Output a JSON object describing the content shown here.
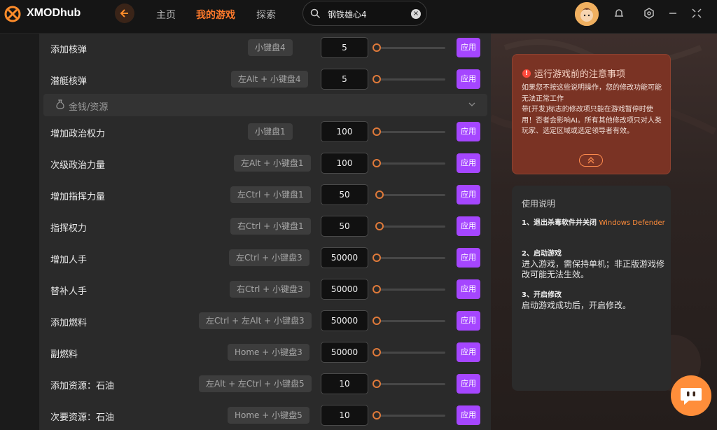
{
  "app": {
    "brand": "XMODhub"
  },
  "nav": {
    "home": "主页",
    "my_games": "我的游戏",
    "explore": "探索"
  },
  "search": {
    "value": "钢铁雄心4",
    "clear_icon": "close-icon"
  },
  "colors": {
    "accent": "#ff7a2b",
    "apply_button": "#a546ff",
    "notice_bg": "#7a3324"
  },
  "rows_top": [
    {
      "label": "添加核弹",
      "hotkey": "小键盘4",
      "value": "5",
      "apply": "应用"
    },
    {
      "label": "潜艇核弹",
      "hotkey": "左Alt + 小键盘4",
      "value": "5",
      "apply": "应用"
    }
  ],
  "section": {
    "label": "金钱/资源"
  },
  "rows": [
    {
      "label": "增加政治权力",
      "hotkey": "小键盘1",
      "value": "100",
      "apply": "应用"
    },
    {
      "label": "次级政治力量",
      "hotkey": "左Alt + 小键盘1",
      "value": "100",
      "apply": "应用"
    },
    {
      "label": "增加指挥力量",
      "hotkey": "左Ctrl + 小键盘1",
      "value": "50",
      "apply": "应用"
    },
    {
      "label": "指挥权力",
      "hotkey": "右Ctrl + 小键盘1",
      "value": "50",
      "apply": "应用"
    },
    {
      "label": "增加人手",
      "hotkey": "左Ctrl + 小键盘3",
      "value": "50000",
      "apply": "应用"
    },
    {
      "label": "替补人手",
      "hotkey": "右Ctrl + 小键盘3",
      "value": "50000",
      "apply": "应用"
    },
    {
      "label": "添加燃料",
      "hotkey": "左Ctrl + 左Alt + 小键盘3",
      "value": "50000",
      "apply": "应用"
    },
    {
      "label": "副燃料",
      "hotkey": "Home + 小键盘3",
      "value": "50000",
      "apply": "应用"
    },
    {
      "label": "添加资源：石油",
      "hotkey": "左Alt + 左Ctrl + 小键盘5",
      "value": "10",
      "apply": "应用"
    },
    {
      "label": "次要资源：石油",
      "hotkey": "Home + 小键盘5",
      "value": "10",
      "apply": "应用"
    }
  ],
  "notice": {
    "title": "运行游戏前的注意事项",
    "body": "如果您不按这些说明操作，您的修改功能可能无法正常工作\n带[开发]标志的修改项只能在游戏暂停时使用！否者会影响AI。所有其他修改项只对人类玩家、选定区域或选定领导者有效。"
  },
  "usage": {
    "title": "使用说明",
    "step1_title": "1、退出杀毒软件并关闭",
    "step1_highlight": "Windows Defender",
    "step2_title": "2、启动游戏",
    "step2_body": "进入游戏，需保持单机；非正版游戏修改可能无法生效。",
    "step3_title": "3、开启修改",
    "step3_body": "启动游戏成功后，开启修改。"
  }
}
